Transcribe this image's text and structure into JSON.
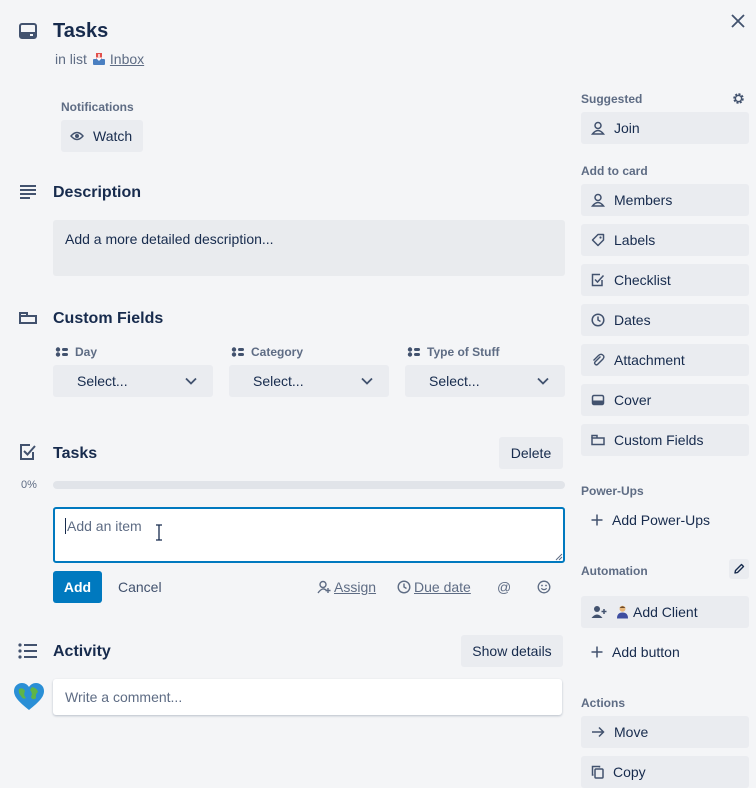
{
  "card": {
    "title": "Tasks",
    "in_list_prefix": "in list",
    "list_name": "Inbox"
  },
  "notifications": {
    "label": "Notifications",
    "watch_label": "Watch"
  },
  "description": {
    "title": "Description",
    "placeholder": "Add a more detailed description..."
  },
  "custom_fields": {
    "title": "Custom Fields",
    "fields": [
      {
        "label": "Day",
        "value": "Select..."
      },
      {
        "label": "Category",
        "value": "Select..."
      },
      {
        "label": "Type of Stuff",
        "value": "Select..."
      }
    ]
  },
  "checklist": {
    "title": "Tasks",
    "delete_label": "Delete",
    "progress_text": "0%",
    "progress": 0,
    "input_placeholder": "Add an item",
    "add_label": "Add",
    "cancel_label": "Cancel",
    "assign_label": "Assign",
    "due_date_label": "Due date"
  },
  "activity": {
    "title": "Activity",
    "show_details_label": "Show details",
    "comment_placeholder": "Write a comment..."
  },
  "sidebar": {
    "suggested_label": "Suggested",
    "join_label": "Join",
    "add_to_card_label": "Add to card",
    "add_items": [
      "Members",
      "Labels",
      "Checklist",
      "Dates",
      "Attachment",
      "Cover",
      "Custom Fields"
    ],
    "powerups_label": "Power-Ups",
    "add_powerups_label": "Add Power-Ups",
    "automation_label": "Automation",
    "add_client_label": "Add Client",
    "add_button_label": "Add button",
    "actions_label": "Actions",
    "move_label": "Move",
    "copy_label": "Copy"
  },
  "colors": {
    "accent": "#0079bf",
    "progress": "#5ba4cf",
    "background": "#f4f5f7"
  }
}
